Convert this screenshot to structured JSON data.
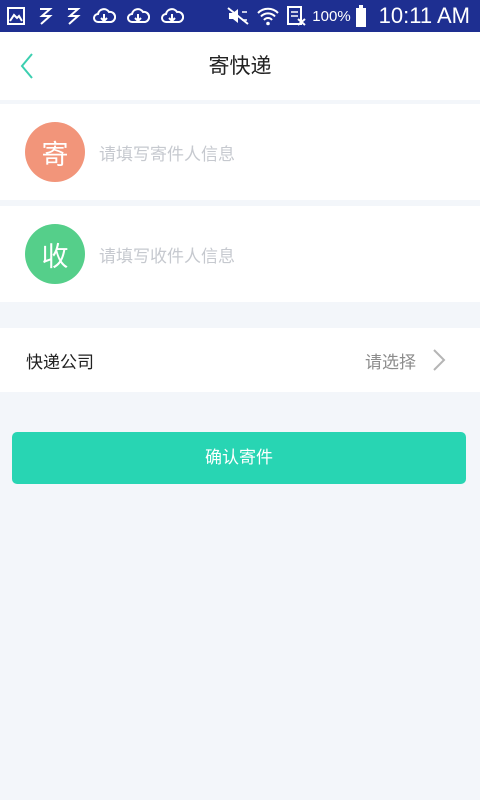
{
  "status_bar": {
    "icons": [
      "gallery-icon",
      "app-icon",
      "app-icon",
      "cloud-icon",
      "cloud-icon",
      "cloud-icon",
      "mute-icon",
      "wifi-icon",
      "nfc-icon",
      "battery-icon"
    ],
    "battery_percent": "100%",
    "time": "10:11 AM",
    "background_color": "#1e2f91"
  },
  "nav": {
    "back_icon": "chevron-left-icon",
    "title": "寄快递"
  },
  "sender": {
    "badge": "寄",
    "placeholder": "请填写寄件人信息",
    "badge_color": "#f2957a"
  },
  "receiver": {
    "badge": "收",
    "placeholder": "请填写收件人信息",
    "badge_color": "#55cf8a"
  },
  "courier": {
    "label": "快递公司",
    "value": "请选择",
    "chevron_icon": "chevron-right-icon"
  },
  "confirm": {
    "label": "确认寄件",
    "color": "#28d5b3"
  },
  "colors": {
    "accent": "#28d5b3",
    "page_background": "#f3f6fa"
  }
}
